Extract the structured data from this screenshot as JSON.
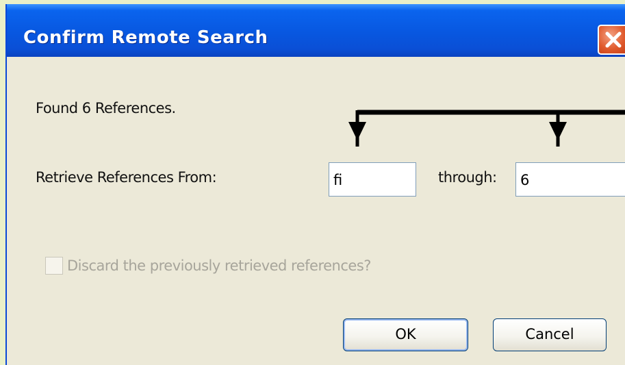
{
  "dialog": {
    "title": "Confirm Remote Search",
    "found_text": "Found 6 References.",
    "retrieve_label": "Retrieve References From:",
    "from_value": "fi",
    "through_label": "through:",
    "through_value": "6",
    "discard_label": "Discard the previously retrieved references?",
    "discard_checked": false,
    "discard_enabled": false,
    "ok_label": "OK",
    "cancel_label": "Cancel"
  },
  "icons": {
    "close": "close-icon",
    "annotation": "arrow-annotation-icon"
  },
  "colors": {
    "titlebar": "#0a57e0",
    "close_button": "#e05a2c",
    "dialog_bg": "#ece9d8",
    "field_border": "#7f9db9",
    "page_bg": "#eaf0c8"
  }
}
